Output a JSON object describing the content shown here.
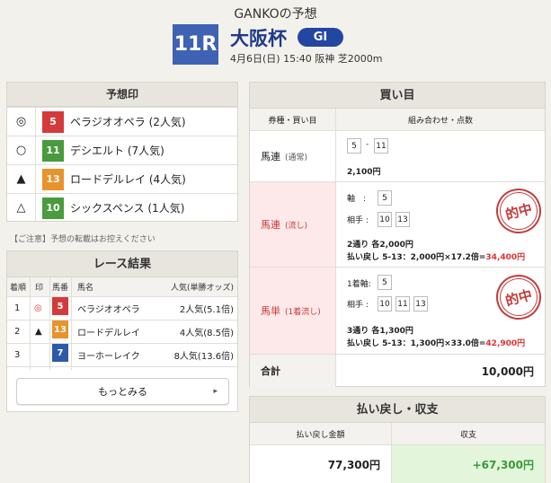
{
  "header": {
    "title": "GANKOの予想",
    "race_number": "11R",
    "race_name": "大阪杯",
    "grade": "GI",
    "info": "4月6日(日) 15:40 阪神 芝2000m"
  },
  "prediction": {
    "title": "予想印",
    "rows": [
      {
        "mark": "◎",
        "num": "5",
        "horse": "ベラジオオペラ (2人気)",
        "color": "#d33b3b"
      },
      {
        "mark": "○",
        "num": "11",
        "horse": "デシエルト (7人気)",
        "color": "#4a9b3e"
      },
      {
        "mark": "▲",
        "num": "13",
        "horse": "ロードデルレイ (4人気)",
        "color": "#e8932c"
      },
      {
        "mark": "△",
        "num": "10",
        "horse": "シックスペンス (1人気)",
        "color": "#4a9b3e"
      }
    ]
  },
  "note": "【ご注意】予想の転載はお控えください",
  "results": {
    "title": "レース結果",
    "headers": {
      "rank": "着順",
      "mark": "印",
      "num": "馬番",
      "name": "馬名",
      "pop": "人気(単勝オッズ)"
    },
    "rows": [
      {
        "rank": "1",
        "mark": "◎",
        "num": "5",
        "name": "ベラジオオペラ",
        "pop": "2人気(5.1倍)",
        "color": "#d33b3b"
      },
      {
        "rank": "2",
        "mark": "▲",
        "num": "13",
        "name": "ロードデルレイ",
        "pop": "4人気(8.5倍)",
        "color": "#e8932c"
      },
      {
        "rank": "3",
        "mark": "",
        "num": "7",
        "name": "ヨーホーレイク",
        "pop": "8人気(13.6倍)",
        "color": "#2c5aa8"
      }
    ],
    "more_label": "もっとみる"
  },
  "bets": {
    "title": "買い目",
    "headers": {
      "type": "券種・買い目",
      "combo": "組み合わせ・点数"
    },
    "rows": [
      {
        "type": "馬連",
        "sub": "(通常)",
        "nums": [
          "5",
          "11"
        ],
        "sep": "-",
        "amount": "2,100円"
      },
      {
        "type": "馬連",
        "sub": "(流し)",
        "axis_label": "軸　:",
        "axis": [
          "5"
        ],
        "partner_label": "相手 :",
        "partners": [
          "10",
          "13"
        ],
        "summary": "2通り 各2,000円",
        "payout_prefix": "払い戻し 5-13：2,000円×17.2倍=",
        "payout": "34,400円",
        "stamp": "的中"
      },
      {
        "type": "馬単",
        "sub": "(1着流し)",
        "axis_label": "1着軸:",
        "axis": [
          "5"
        ],
        "partner_label": "相手 :",
        "partners": [
          "10",
          "11",
          "13"
        ],
        "summary": "3通り 各1,300円",
        "payout_prefix": "払い戻し 5-13：1,300円×33.0倍=",
        "payout": "42,900円",
        "stamp": "的中"
      }
    ],
    "total_label": "合計",
    "total_value": "10,000円"
  },
  "payout": {
    "title": "払い戻し・収支",
    "headers": {
      "amount": "払い戻し金額",
      "balance": "収支"
    },
    "amount": "77,300円",
    "balance": "+67,300円"
  }
}
